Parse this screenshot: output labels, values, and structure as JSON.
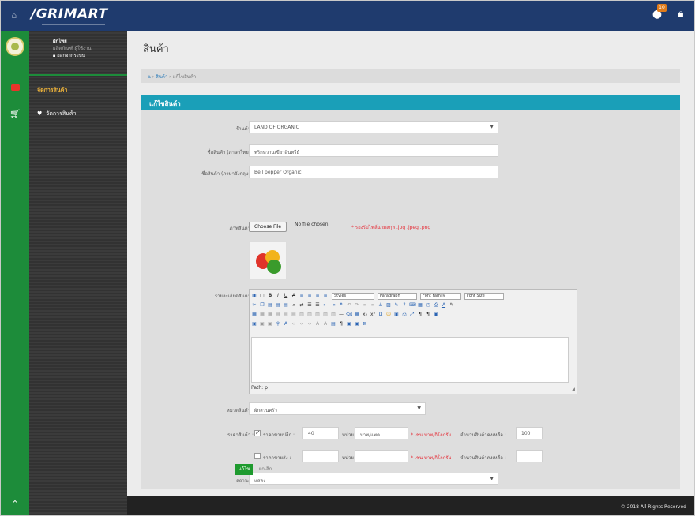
{
  "app": {
    "logo": "/GRIMART",
    "notification_count": "10"
  },
  "user": {
    "name": "ผักไทย",
    "role": "ผลิตภัณฑ์ ผู้ใช้งาน",
    "logout": "ออกจากระบบ"
  },
  "sidebar": {
    "menu_main": "จัดการสินค้า",
    "menu_sub": "จัดการสินค้า"
  },
  "page": {
    "title": "สินค้า"
  },
  "breadcrumb": {
    "sep": "›",
    "items": [
      "สินค้า",
      "แก้ไขสินค้า"
    ]
  },
  "panel": {
    "title": "แก้ไขสินค้า"
  },
  "form": {
    "shop": {
      "label": "ร้านค้า :",
      "value": "LAND OF ORGANIC"
    },
    "name_th": {
      "label": "ชื่อสินค้า (ภาษาไทย) :",
      "value": "พริกหวานเขียวอินทรีย์"
    },
    "name_en": {
      "label": "ชื่อสินค้า (ภาษาอังกฤษ) :",
      "value": "Bell pepper Organic"
    },
    "image": {
      "label": "ภาพสินค้า :",
      "choose_label": "Choose File",
      "no_file": "No file chosen",
      "hint": "* รองรับไฟล์นามสกุล .jpg .jpeg .png"
    },
    "detail": {
      "label": "รายละเอียดสินค้า :",
      "path": "Path: p",
      "styles": "Styles",
      "paragraph": "Paragraph",
      "font_family": "Font Family",
      "font_size": "Font Size"
    },
    "category": {
      "label": "หมวดสินค้า :",
      "value": "ผักสวนครัว"
    },
    "price": {
      "label": "ราคาสินค้า :",
      "normal": {
        "checked": true,
        "label": "ราคาขายปลีก :",
        "value": "40",
        "unit_label": "หน่วย",
        "unit_value": "บาท/แพค",
        "hint": "* เช่น บาท/กิโลกรัม",
        "remain_label": "จำนวนสินค้าคงเหลือ :",
        "remain_value": "100"
      },
      "wholesale": {
        "checked": false,
        "label": "ราคาขายส่ง :",
        "value": "",
        "unit_label": "หน่วย",
        "unit_value": "",
        "hint": "* เช่น บาท/กิโลกรัม",
        "remain_label": "จำนวนสินค้าคงเหลือ :",
        "remain_value": ""
      }
    },
    "status": {
      "label": "สถานะ :",
      "value": "แสดง"
    },
    "save_label": "แก้ไข",
    "cancel_label": "ยกเลิก"
  },
  "footer": {
    "copyright": "© 2018 All Rights Reserved"
  },
  "colors": {
    "topbar": "#1f3b6e",
    "sidebar_green": "#1d8c3a",
    "panel_head": "#1a9fb8",
    "save_btn": "#1e9a2e",
    "hint_red": "#e5303a"
  }
}
